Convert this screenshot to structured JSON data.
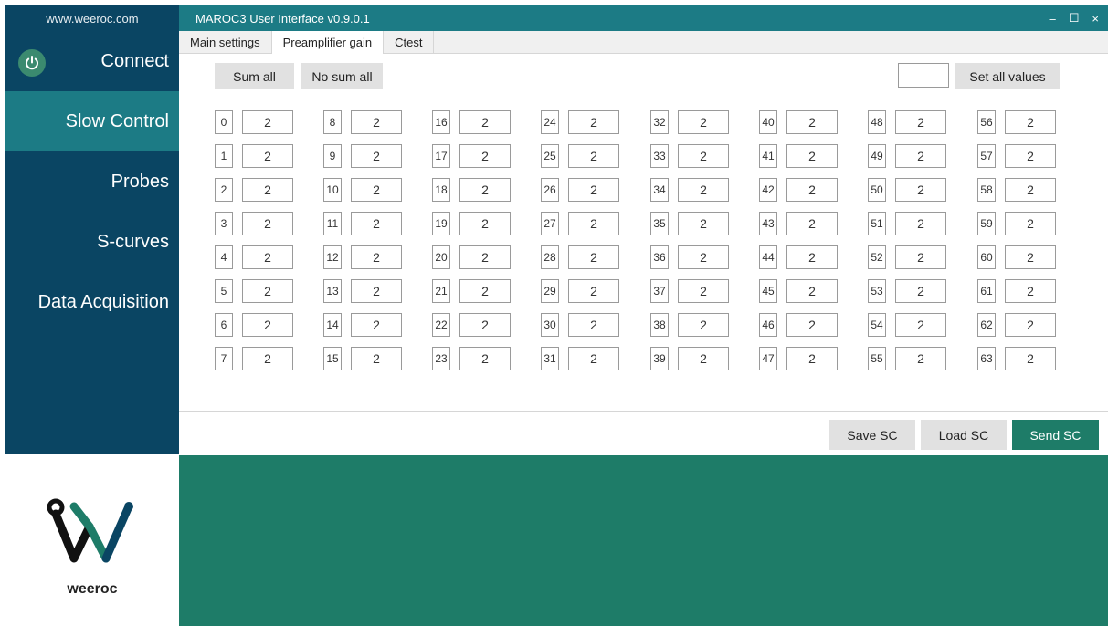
{
  "sidebar": {
    "site": "www.weeroc.com",
    "items": [
      {
        "label": "Connect"
      },
      {
        "label": "Slow Control"
      },
      {
        "label": "Probes"
      },
      {
        "label": "S-curves"
      },
      {
        "label": "Data Acquisition"
      }
    ],
    "logo_text": "weeroc"
  },
  "window": {
    "title": "MAROC3 User Interface v0.9.0.1",
    "minimize": "–",
    "maximize": "☐",
    "close": "×"
  },
  "tabs": [
    {
      "label": "Main settings"
    },
    {
      "label": "Preamplifier gain"
    },
    {
      "label": "Ctest"
    }
  ],
  "toolbar": {
    "sum_all": "Sum all",
    "no_sum_all": "No sum all",
    "set_all_value": "",
    "set_all_values": "Set all values"
  },
  "channels": [
    {
      "ch": "0",
      "gain": "2"
    },
    {
      "ch": "1",
      "gain": "2"
    },
    {
      "ch": "2",
      "gain": "2"
    },
    {
      "ch": "3",
      "gain": "2"
    },
    {
      "ch": "4",
      "gain": "2"
    },
    {
      "ch": "5",
      "gain": "2"
    },
    {
      "ch": "6",
      "gain": "2"
    },
    {
      "ch": "7",
      "gain": "2"
    },
    {
      "ch": "8",
      "gain": "2"
    },
    {
      "ch": "9",
      "gain": "2"
    },
    {
      "ch": "10",
      "gain": "2"
    },
    {
      "ch": "11",
      "gain": "2"
    },
    {
      "ch": "12",
      "gain": "2"
    },
    {
      "ch": "13",
      "gain": "2"
    },
    {
      "ch": "14",
      "gain": "2"
    },
    {
      "ch": "15",
      "gain": "2"
    },
    {
      "ch": "16",
      "gain": "2"
    },
    {
      "ch": "17",
      "gain": "2"
    },
    {
      "ch": "18",
      "gain": "2"
    },
    {
      "ch": "19",
      "gain": "2"
    },
    {
      "ch": "20",
      "gain": "2"
    },
    {
      "ch": "21",
      "gain": "2"
    },
    {
      "ch": "22",
      "gain": "2"
    },
    {
      "ch": "23",
      "gain": "2"
    },
    {
      "ch": "24",
      "gain": "2"
    },
    {
      "ch": "25",
      "gain": "2"
    },
    {
      "ch": "26",
      "gain": "2"
    },
    {
      "ch": "27",
      "gain": "2"
    },
    {
      "ch": "28",
      "gain": "2"
    },
    {
      "ch": "29",
      "gain": "2"
    },
    {
      "ch": "30",
      "gain": "2"
    },
    {
      "ch": "31",
      "gain": "2"
    },
    {
      "ch": "32",
      "gain": "2"
    },
    {
      "ch": "33",
      "gain": "2"
    },
    {
      "ch": "34",
      "gain": "2"
    },
    {
      "ch": "35",
      "gain": "2"
    },
    {
      "ch": "36",
      "gain": "2"
    },
    {
      "ch": "37",
      "gain": "2"
    },
    {
      "ch": "38",
      "gain": "2"
    },
    {
      "ch": "39",
      "gain": "2"
    },
    {
      "ch": "40",
      "gain": "2"
    },
    {
      "ch": "41",
      "gain": "2"
    },
    {
      "ch": "42",
      "gain": "2"
    },
    {
      "ch": "43",
      "gain": "2"
    },
    {
      "ch": "44",
      "gain": "2"
    },
    {
      "ch": "45",
      "gain": "2"
    },
    {
      "ch": "46",
      "gain": "2"
    },
    {
      "ch": "47",
      "gain": "2"
    },
    {
      "ch": "48",
      "gain": "2"
    },
    {
      "ch": "49",
      "gain": "2"
    },
    {
      "ch": "50",
      "gain": "2"
    },
    {
      "ch": "51",
      "gain": "2"
    },
    {
      "ch": "52",
      "gain": "2"
    },
    {
      "ch": "53",
      "gain": "2"
    },
    {
      "ch": "54",
      "gain": "2"
    },
    {
      "ch": "55",
      "gain": "2"
    },
    {
      "ch": "56",
      "gain": "2"
    },
    {
      "ch": "57",
      "gain": "2"
    },
    {
      "ch": "58",
      "gain": "2"
    },
    {
      "ch": "59",
      "gain": "2"
    },
    {
      "ch": "60",
      "gain": "2"
    },
    {
      "ch": "61",
      "gain": "2"
    },
    {
      "ch": "62",
      "gain": "2"
    },
    {
      "ch": "63",
      "gain": "2"
    }
  ],
  "actions": {
    "save": "Save SC",
    "load": "Load SC",
    "send": "Send SC"
  },
  "colors": {
    "sidebar": "#0a4563",
    "active": "#1c7b85",
    "accent": "#1e7c68"
  }
}
